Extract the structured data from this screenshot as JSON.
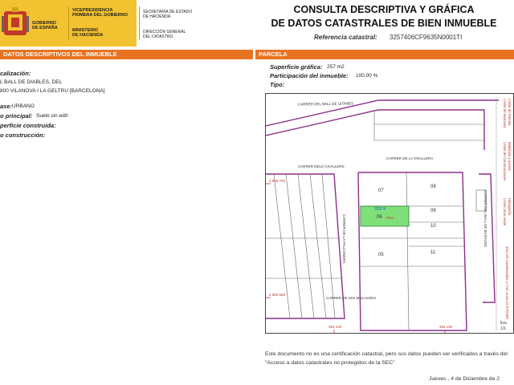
{
  "header": {
    "gov_left_1": "GOBIERNO",
    "gov_left_2": "DE ESPAÑA",
    "gov_mid_1": "VICEPRESIDENCIA",
    "gov_mid_2": "PRIMERA DEL GOBIERNO",
    "gov_mid_3": "MINISTERIO",
    "gov_mid_4": "DE HACIENDA",
    "gov_right_1": "SECRETARÍA DE ESTADO",
    "gov_right_2": "DE HACIENDA",
    "gov_right_3": "DIRECCIÓN GENERAL",
    "gov_right_4": "DEL CATASTRO",
    "title_line1": "CONSULTA DESCRIPTIVA Y GRÁFICA",
    "title_line2": "DE DATOS CATASTRALES DE BIEN INMUEBLE",
    "ref_label": "Referencia catastral:",
    "ref_value": "3257406CF9635N0001TI"
  },
  "left_section": {
    "bar_title": "DATOS DESCRIPTIVOS DEL INMUEBLE",
    "localizacion_label": "calización:",
    "localizacion_line1": "L BALL DE DIABLES, DEL",
    "localizacion_line2": "800 VILANOVA I LA GELTRU [BARCELONA]",
    "clase_label": "ase:",
    "clase_value": "URBANO",
    "uso_label": "o principal:",
    "uso_value": "Suelo sin edif.",
    "superficie_label": "perficie construida:",
    "anyo_label": "o construcción:"
  },
  "parcela": {
    "bar_title": "PARCELA",
    "superficie_label": "Superficie gráfica:",
    "superficie_value": "257 m2",
    "participacion_label": "Participación del inmueble:",
    "participacion_value": "100,00 %",
    "tipo_label": "Tipo:"
  },
  "map": {
    "street_1": "CARRER DEL BALL DE GITANES",
    "street_2": "CARRER DELS CIVALLERS",
    "street_3": "CARRER DE LA GRALLERA",
    "street_4": "CARRER DE LES MULASSES",
    "street_5": "CARRER DE LA FALCONERA",
    "street_6": "CARRER DEL BALL DE BASTONS",
    "coord_y1": "4 560 700",
    "coord_y2": "4 560 650",
    "coord_x1": "393 100",
    "coord_x2": "393 150",
    "parcel_label": "32574",
    "parcel_sub": "06",
    "parcel_tag": "Parc.",
    "lot_07": "07",
    "lot_08": "08",
    "lot_09": "09",
    "lot_10": "10",
    "lot_11": "11",
    "lot_05": "05",
    "legend_1": "Límite de Manzana",
    "legend_2": "Límite de Parcela",
    "legend_3": "Límite de Construcciones",
    "legend_4": "Mobiliario y aceras",
    "legend_5": "Límite zona verde",
    "legend_6": "Hidrografía",
    "side_text": "393,120 Coordenadas U.T.M. Huso 31 ETRS89",
    "scale_1": "Esc",
    "scale_2": "1/1"
  },
  "footer": {
    "disclaimer": "Este documento no es una certificación catastral, pero sus datos pueden ser verificados a través del \"Acceso a datos catastrales no protegidos de la SEC\"",
    "date": "Jueves , 4 de Diciembre de 2"
  },
  "colors": {
    "accent_orange": "#e8731f",
    "gov_yellow": "#f2c230",
    "block_purple": "#8b2f8b",
    "parcel_green": "#7fe07a",
    "legend_red": "#c0392b"
  }
}
